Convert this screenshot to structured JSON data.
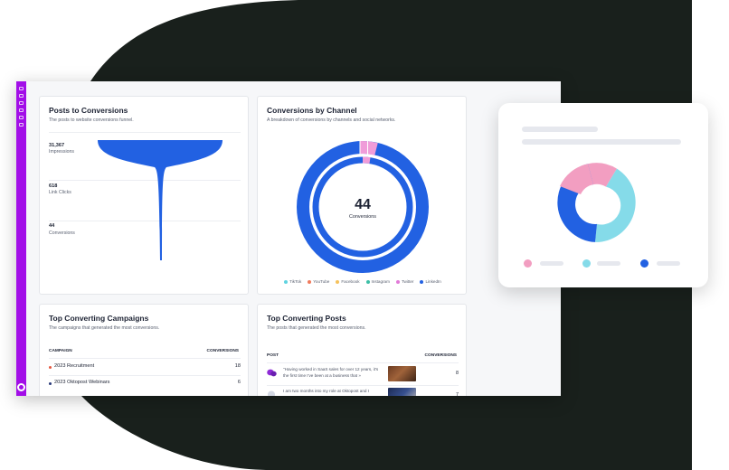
{
  "colors": {
    "background_blob": "#19201c",
    "sidebar": "#a20ee8",
    "funnel": "#2261e2",
    "donut_primary": "#2261e2",
    "donut_pink": "#f09cd9"
  },
  "funnel_card": {
    "title": "Posts to Conversions",
    "subtitle": "The posts to website conversions funnel.",
    "stages": [
      {
        "value": "31,367",
        "label": "Impressions"
      },
      {
        "value": "618",
        "label": "Link Clicks"
      },
      {
        "value": "44",
        "label": "Conversions"
      }
    ]
  },
  "channel_card": {
    "title": "Conversions by Channel",
    "subtitle": "A breakdown of conversions by channels and social networks.",
    "total_value": "44",
    "total_label": "Conversions",
    "legend": [
      {
        "label": "TikTok",
        "color": "#5fd3e0"
      },
      {
        "label": "YouTube",
        "color": "#f07a5c"
      },
      {
        "label": "Facebook",
        "color": "#f5c25c"
      },
      {
        "label": "Instagram",
        "color": "#3dbfa6"
      },
      {
        "label": "Twitter",
        "color": "#e27ad8"
      },
      {
        "label": "LinkedIn",
        "color": "#2261e2"
      }
    ]
  },
  "campaigns_card": {
    "title": "Top Converting Campaigns",
    "subtitle": "The campaigns that generated the most conversions.",
    "col_campaign": "CAMPAIGN",
    "col_conversions": "CONVERSIONS",
    "rows": [
      {
        "name": "2023 Recruitment",
        "value": "18",
        "color": "#e5573f"
      },
      {
        "name": "2023 Oktopost Webinars",
        "value": "6",
        "color": "#2a3a7a"
      }
    ]
  },
  "posts_card": {
    "title": "Top Converting Posts",
    "subtitle": "The posts that generated the most conversions.",
    "col_post": "POST",
    "col_conversions": "CONVERSIONS",
    "rows": [
      {
        "text": "\"Having worked in SaaS sales for over 12 years, it's the first time I've been at a business that »",
        "value": "8"
      },
      {
        "text": "I am two months into my role at Oktopost and I",
        "value": "7"
      }
    ]
  },
  "float_card": {
    "segments": [
      {
        "name": "pink",
        "color": "#f29ec1"
      },
      {
        "name": "cyan",
        "color": "#85dbe9"
      },
      {
        "name": "blue",
        "color": "#2261e2"
      }
    ]
  }
}
